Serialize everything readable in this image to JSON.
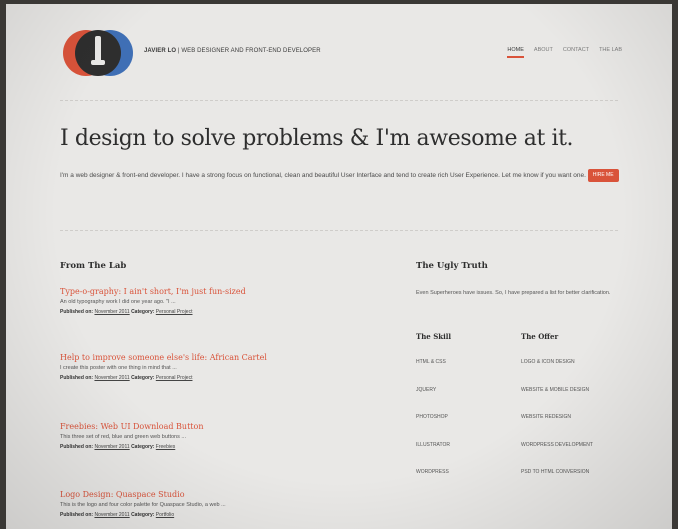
{
  "header": {
    "brand_name": "JAVIER LO",
    "brand_tagline": "| WEB DESIGNER AND FRONT-END DEVELOPER",
    "nav": [
      {
        "label": "HOME",
        "active": true
      },
      {
        "label": "ABOUT",
        "active": false
      },
      {
        "label": "CONTACT",
        "active": false
      },
      {
        "label": "THE LAB",
        "active": false
      }
    ]
  },
  "hero": {
    "headline": "I design to solve problems & I'm awesome at it.",
    "intro": "I'm a web designer & front-end developer. I have a strong focus on functional, clean and beautiful User Interface and tend to create rich User Experience. Let me know if you want one.",
    "hire_label": "HIRE ME"
  },
  "lab": {
    "title": "From The Lab",
    "meta_published_label": "Published on:",
    "meta_category_label": "Category:",
    "posts": [
      {
        "title": "Type-o-graphy: I ain't short, I'm just fun-sized",
        "excerpt": "An old typography work I did one year ago. \"I ...",
        "date": "November 2011",
        "category": "Personal Project"
      },
      {
        "title": "Help to improve someone else's life: African Cartel",
        "excerpt": "I create this poster with one thing in mind that ...",
        "date": "November 2011",
        "category": "Personal Project"
      },
      {
        "title": "Freebies: Web UI Download Button",
        "excerpt": "This three set of red, blue and green web buttons ...",
        "date": "November 2011",
        "category": "Freebies"
      },
      {
        "title": "Logo Design: Quaspace Studio",
        "excerpt": "This is the logo and four color palette for Quaspace Studio, a web ...",
        "date": "November 2011",
        "category": "Portfolio"
      }
    ]
  },
  "truth": {
    "title": "The Ugly Truth",
    "text": "Even Superheroes have issues. So, I have prepared a list for better clarification.",
    "skill_header": "The Skill",
    "offer_header": "The Offer",
    "skills": [
      "HTML & CSS",
      "JQUERY",
      "PHOTOSHOP",
      "ILLUSTRATOR",
      "WORDPRESS"
    ],
    "offers": [
      "LOGO & ICON DESIGN",
      "WEBSITE & MOBILE DESIGN",
      "WEBSITE REDESIGN",
      "WORDPRESS DEVELOPMENT",
      "PSD TO HTML CONVERSION"
    ]
  },
  "colors": {
    "accent": "#d9533a",
    "logo_red": "#d9533a",
    "logo_blue": "#3f6fb5",
    "logo_dark": "#2e2e2e",
    "background": "#e9e8e6"
  }
}
